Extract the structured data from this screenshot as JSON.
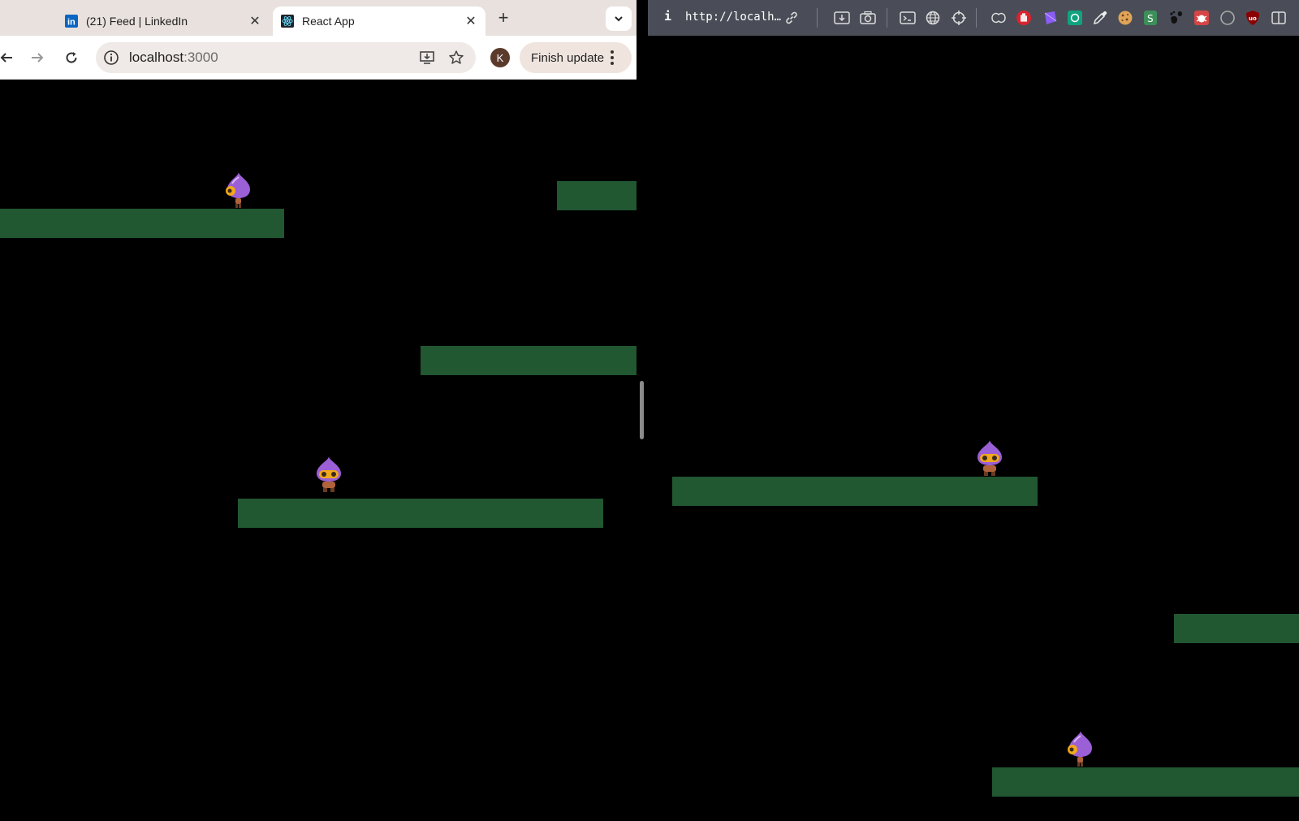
{
  "left_browser": {
    "tabs": [
      {
        "title": "(21) Feed | LinkedIn",
        "active": false,
        "favicon": "linkedin-icon"
      },
      {
        "title": "React App",
        "active": true,
        "favicon": "react-icon"
      }
    ],
    "new_tab_label": "+",
    "address": {
      "host": "localhost",
      "port": ":3000"
    },
    "profile_initial": "K",
    "finish_update_label": "Finish update"
  },
  "right_browser": {
    "url": "http://localh…",
    "extension_icons": [
      "info-icon",
      "link-icon",
      "download-icon",
      "camera-icon",
      "terminal-icon",
      "globe-icon",
      "crosshair-icon",
      "puzzle-icon",
      "stop-hand-icon",
      "gem-icon",
      "openai-icon",
      "eyedropper-icon",
      "cookie-icon",
      "extension-icon",
      "gnome-icon",
      "bug-icon",
      "circle-icon",
      "ublock-icon",
      "sidebar-icon"
    ]
  },
  "colors": {
    "platform": "#215731",
    "background": "#000000",
    "character_purple": "#9b5fd6",
    "character_face": "#f1a81c"
  }
}
